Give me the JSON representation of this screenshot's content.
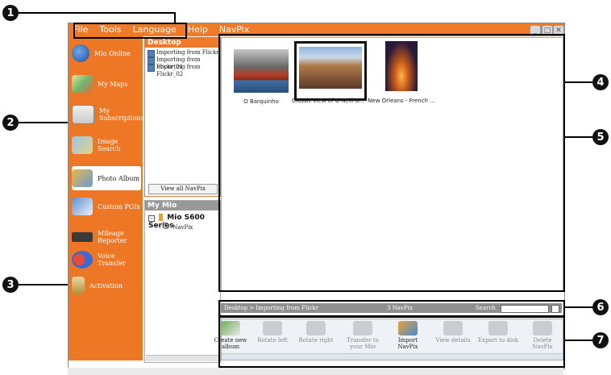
{
  "callouts": [
    "1",
    "2",
    "3",
    "4",
    "5",
    "6",
    "7"
  ],
  "menu": [
    "File",
    "Tools",
    "Language",
    "Help",
    "NavPix"
  ],
  "window_buttons": [
    "_",
    "□",
    "✕"
  ],
  "sidebar": {
    "items": [
      {
        "label": "Mio Online",
        "icon": "globe-icon"
      },
      {
        "label": "My Maps",
        "icon": "map-icon"
      },
      {
        "label": "My Subscriptions",
        "icon": "envelope-icon"
      },
      {
        "label": "Image Search",
        "icon": "image-search-icon"
      },
      {
        "label": "Photo Album",
        "icon": "photo-album-icon"
      },
      {
        "label": "Custom POIs",
        "icon": "poi-icon"
      },
      {
        "label": "Mileage Reporter",
        "icon": "odometer-icon"
      },
      {
        "label": "Voice Transfer",
        "icon": "voice-icon"
      },
      {
        "label": "Activation",
        "icon": "key-icon"
      }
    ]
  },
  "desktop_panel": {
    "title": "Desktop",
    "items": [
      "Importing from Flickr",
      "Importing from Flickr_01",
      "Importing from Flickr_02"
    ],
    "view_all": "View all NavPix"
  },
  "mymio_panel": {
    "title": "My Mio",
    "device": "Mio S600 Series",
    "child": "NavPix"
  },
  "photos": [
    {
      "caption": "O Barquinho"
    },
    {
      "caption": "Classic view of O'Neill B..."
    },
    {
      "caption": "New Orleans - French ..."
    }
  ],
  "status": {
    "path": "Desktop > Importing from Flickr",
    "count": "3 NavPix",
    "search_label": "Search"
  },
  "toolbar": [
    {
      "label": "Create new album",
      "icon": "add-album-icon"
    },
    {
      "label": "Rotate left",
      "icon": "rotate-left-icon"
    },
    {
      "label": "Rotate right",
      "icon": "rotate-right-icon"
    },
    {
      "label": "Transfer to your Mio",
      "icon": "transfer-icon"
    },
    {
      "label": "Import NavPix",
      "icon": "import-icon"
    },
    {
      "label": "View details",
      "icon": "details-icon"
    },
    {
      "label": "Export to disk",
      "icon": "export-icon"
    },
    {
      "label": "Delete NavPix",
      "icon": "delete-icon"
    }
  ],
  "colors": {
    "accent": "#ef7a2a",
    "status_grey": "#8f8f8f"
  }
}
